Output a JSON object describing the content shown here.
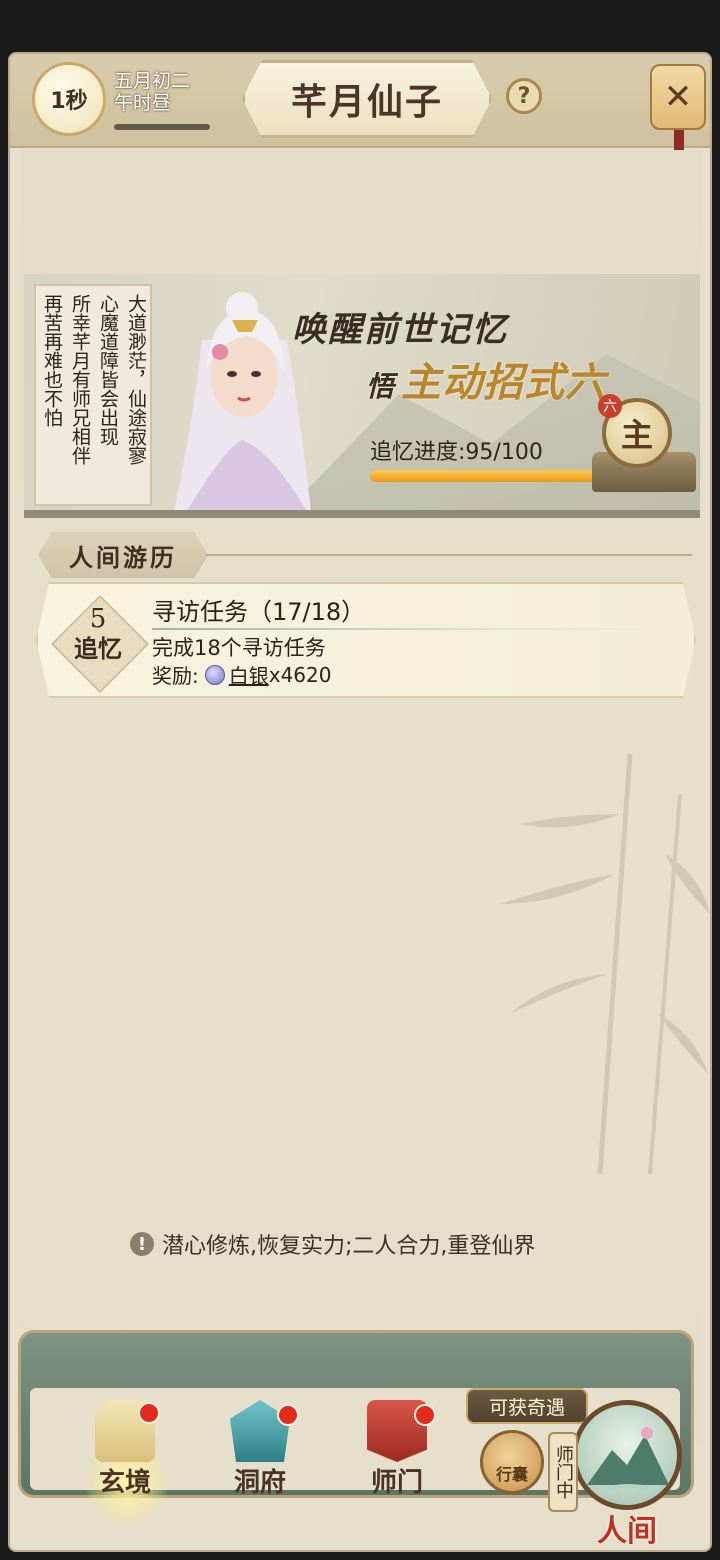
{
  "header": {
    "timer": "1秒",
    "date_line1": "五月初二",
    "date_line2": "午时昼",
    "title": "芊月仙子",
    "help": "?",
    "close": "✕"
  },
  "banner": {
    "poem_lines": [
      "大道渺茫，仙途寂寥",
      "心魔道障皆会出现",
      "所幸芊月有师兄相伴",
      "再苦再难也不怕"
    ],
    "headline_1": "唤醒前世记忆",
    "headline_2_lead": "悟",
    "headline_2": "主动招式六",
    "progress_label": "追忆进度:95/100",
    "progress_fraction": 0.95,
    "seal_char": "主",
    "seal_tag": "六"
  },
  "section": {
    "title": "人间游历"
  },
  "task": {
    "badge_num": "5",
    "badge_word": "追忆",
    "title": "寻访任务（17/18）",
    "desc": "完成18个寻访任务",
    "reward_label": "奖励:",
    "reward_item": "白银",
    "reward_amount": "x4620"
  },
  "tip": {
    "icon": "!",
    "text": "潜心修炼,恢复实力;二人合力,重登仙界"
  },
  "nav": {
    "items": [
      {
        "label": "玄境"
      },
      {
        "label": "洞府"
      },
      {
        "label": "师门"
      }
    ],
    "bag_label": "行囊",
    "chance_tag": "可获奇遇",
    "sect_tag": "师门中",
    "world_label": "人间"
  },
  "colors": {
    "accent": "#c8a96a",
    "progress": "#f0a92a",
    "red_dot": "#e22b1e"
  }
}
